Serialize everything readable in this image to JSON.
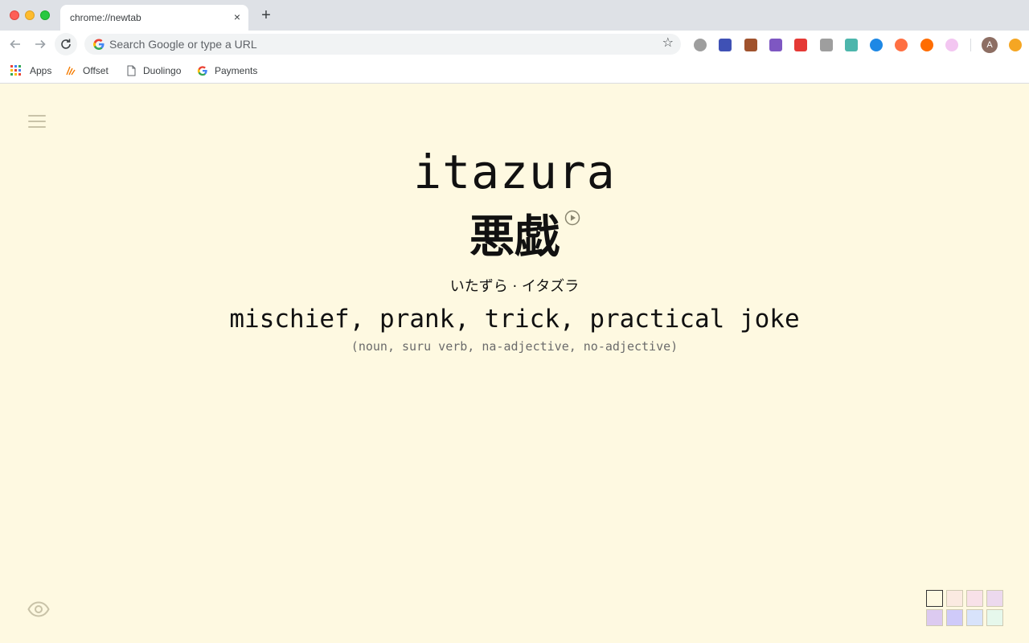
{
  "browser": {
    "tab_title": "chrome://newtab",
    "tab_close": "×",
    "new_tab": "+",
    "omnibox_placeholder": "Search Google or type a URL",
    "avatar_initial": "A",
    "bookmarks": [
      {
        "label": "Apps",
        "icon": "apps-grid-icon"
      },
      {
        "label": "Offset",
        "icon": "offset-icon"
      },
      {
        "label": "Duolingo",
        "icon": "page-icon"
      },
      {
        "label": "Payments",
        "icon": "google-icon"
      }
    ],
    "extensions": [
      {
        "name": "m-extension-icon",
        "color": "#9e9e9e"
      },
      {
        "name": "bar-chart-extension-icon",
        "color": "#3f51b5"
      },
      {
        "name": "cookie-extension-icon",
        "color": "#a0522d"
      },
      {
        "name": "face-extension-icon",
        "color": "#7e57c2"
      },
      {
        "name": "red-translate-extension-icon",
        "color": "#e53935"
      },
      {
        "name": "crx-extension-icon",
        "color": "#9e9e9e"
      },
      {
        "name": "grid-extension-icon",
        "color": "#4db6ac"
      },
      {
        "name": "blue-wave-extension-icon",
        "color": "#1e88e5"
      },
      {
        "name": "t-extension-icon",
        "color": "#ff7043"
      },
      {
        "name": "orange-ring-extension-icon",
        "color": "#ff6d00"
      },
      {
        "name": "pink-circle-extension-icon",
        "color": "#f3c6f1"
      },
      {
        "name": "orange-badge-extension-icon",
        "color": "#f5a623"
      }
    ]
  },
  "word": {
    "romaji": "itazura",
    "kanji": "悪戯",
    "kana": "いたずら · イタズラ",
    "meaning": "mischief, prank, trick, practical joke",
    "part_of_speech": "(noun, suru verb, na-adjective, no-adjective)"
  },
  "theme": {
    "background": "#fef9e1",
    "swatches": [
      "#fef9e1",
      "#fbeae1",
      "#f8e1e8",
      "#ecd9ee",
      "#dccaf0",
      "#cfcaf9",
      "#d8e3fb",
      "#e6f8ec"
    ],
    "selected_swatch": 0
  }
}
